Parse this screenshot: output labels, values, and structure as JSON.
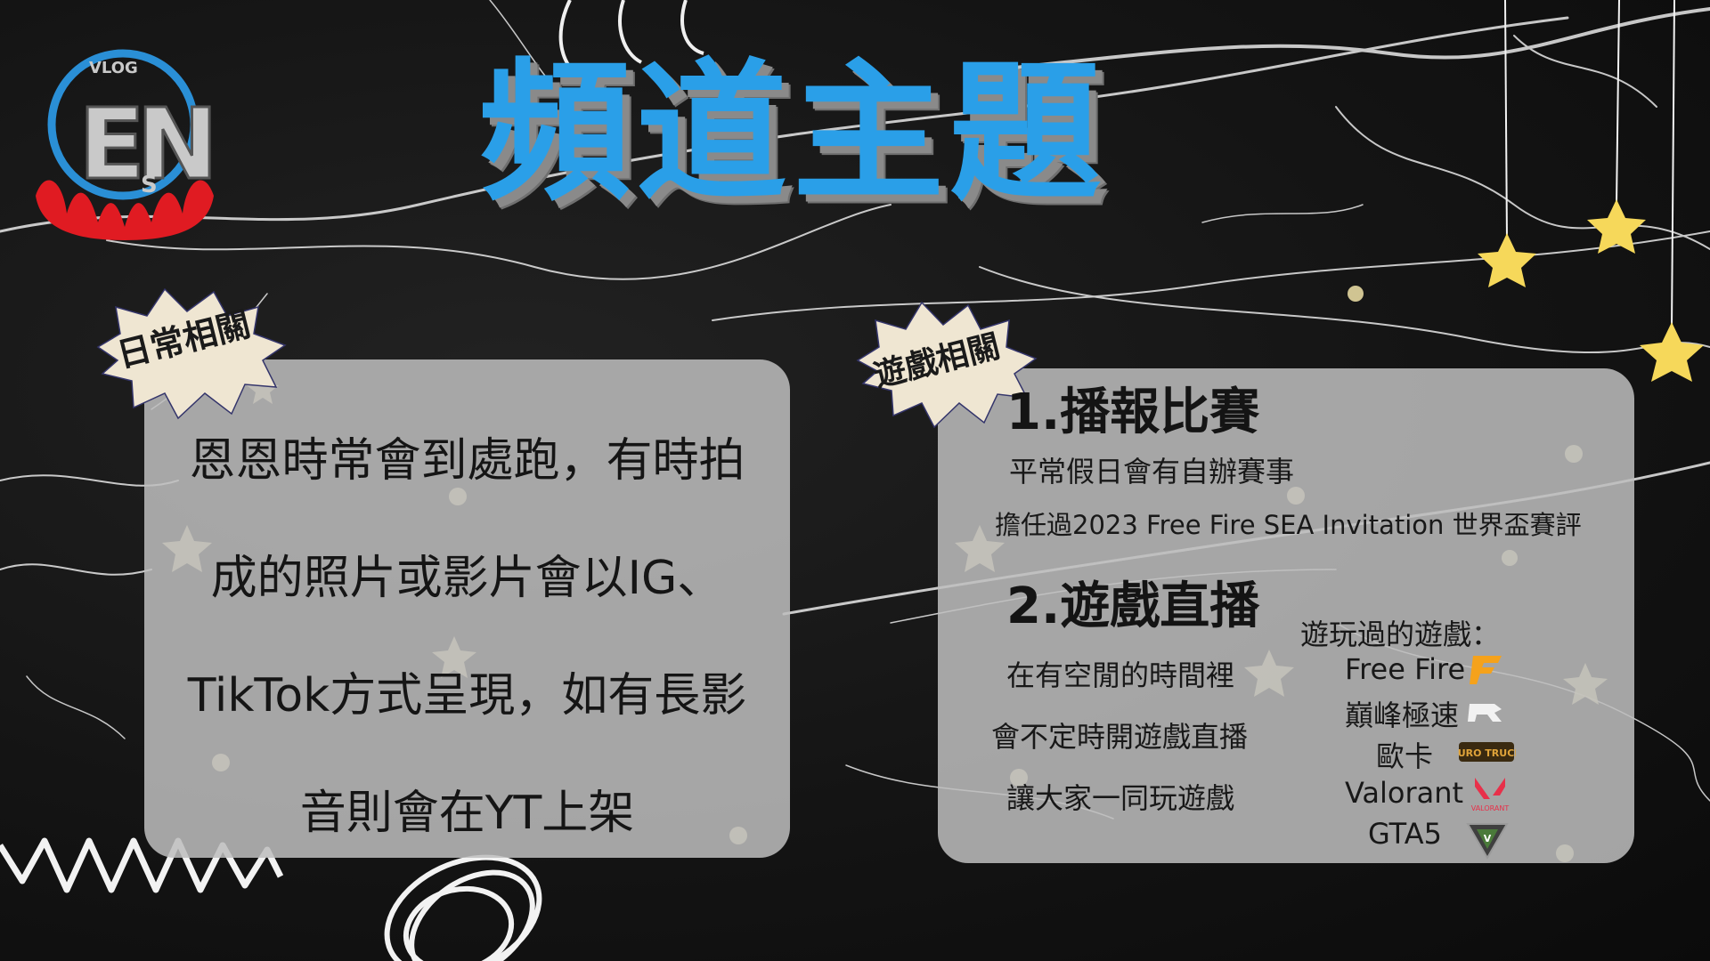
{
  "title": "頻道主題",
  "logo": {
    "text_top": "VLOG",
    "letters": "EN",
    "letter_s": "S",
    "colors": {
      "ring": "#2a8fd6",
      "flame": "#e01b22",
      "letters": "#c9c9c9"
    }
  },
  "colors": {
    "title": "#2a9fe8",
    "panel": "#bebebe",
    "burst": "#efe6d2",
    "star": "#f6d85a"
  },
  "left_section": {
    "badge": "日常相關",
    "lines": [
      "恩恩時常會到處跑，有時拍",
      "成的照片或影片會以IG、",
      "TikTok方式呈現，如有長影",
      "音則會在YT上架"
    ]
  },
  "right_section": {
    "badge": "遊戲相關",
    "heading1": "1.播報比賽",
    "line1": "平常假日會有自辦賽事",
    "line2": "擔任過2023  Free Fire SEA Invitation 世界盃賽評",
    "heading2": "2.遊戲直播",
    "stream_lines": [
      "在有空閒的時間裡",
      "會不定時開遊戲直播",
      "讓大家一同玩遊戲"
    ],
    "games_title": "遊玩過的遊戲：",
    "games": [
      {
        "name": "Free Fire",
        "icon": "free-fire-icon",
        "color": "#f5a21b"
      },
      {
        "name": "巔峰極速",
        "icon": "racing-master-icon",
        "color": "#ffffff"
      },
      {
        "name": "歐卡",
        "icon": "euro-truck-icon",
        "color": "#b87a1c"
      },
      {
        "name": "Valorant",
        "icon": "valorant-icon",
        "color": "#e8304a"
      },
      {
        "name": "GTA5",
        "icon": "gta5-icon",
        "color": "#4a7a3a"
      }
    ]
  }
}
